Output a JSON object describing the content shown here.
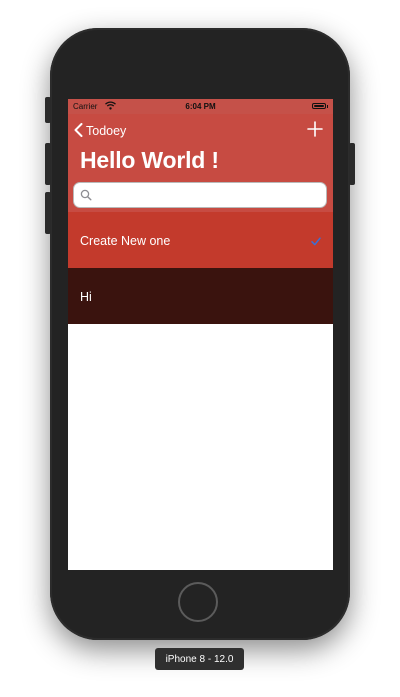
{
  "status_bar": {
    "carrier": "Carrier",
    "time": "6:04 PM",
    "wifi_icon": "wifi-icon",
    "battery_icon": "battery-icon"
  },
  "nav": {
    "back_label": "Todoey",
    "title": "Hello World !",
    "back_icon": "chevron-left-icon",
    "add_icon": "plus-icon"
  },
  "search": {
    "value": "",
    "placeholder": "",
    "icon": "search-icon"
  },
  "items": [
    {
      "label": "Create New one",
      "done": true
    },
    {
      "label": "Hi",
      "done": false
    }
  ],
  "device_label": "iPhone 8 - 12.0",
  "colors": {
    "nav_background": "#c74b42",
    "row_1_background": "#c33a2c",
    "row_2_background": "#3a130e",
    "checkmark": "#3b6fd6",
    "phone_body": "#232323"
  }
}
